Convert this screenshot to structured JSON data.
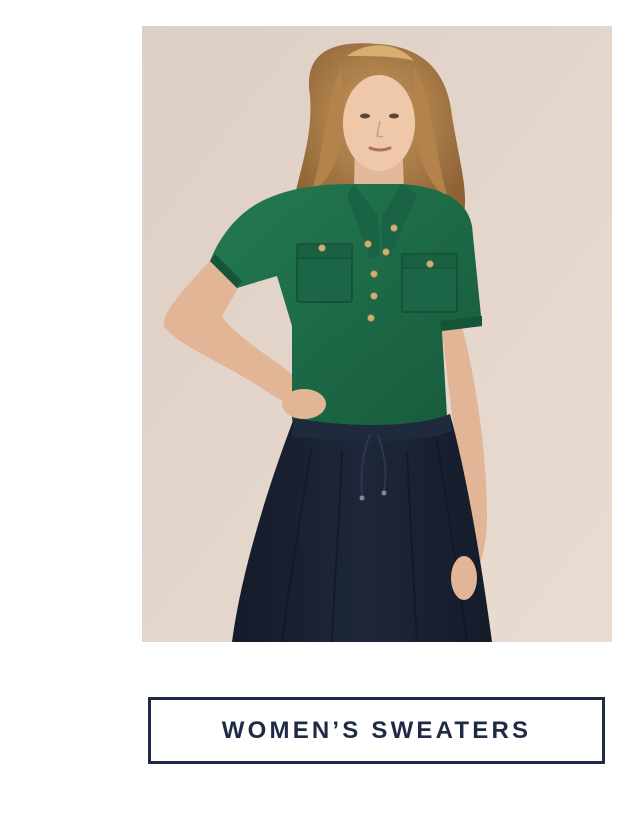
{
  "hero": {
    "alt": "Woman wearing a green short-sleeve knit polo sweater with gold buttons and a navy drawstring skirt",
    "colors": {
      "background": "#e6d7cc",
      "sweater": "#1d6b48",
      "skirt": "#1a2233",
      "buttons": "#c9b27a"
    }
  },
  "cta": {
    "label": "WOMEN’S SWEATERS",
    "color": "#1f2a44"
  }
}
